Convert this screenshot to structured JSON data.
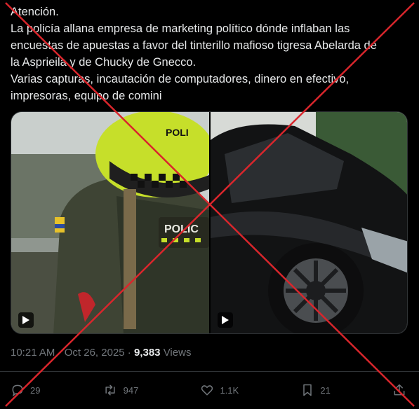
{
  "post": {
    "lines": [
      "Atención.",
      "La policía allana empresa de marketing político dónde inflaban las",
      "encuestas de apuestas a favor del tinterillo mafioso tigresa Abelarda de",
      "la Asprieila y de Chucky de Gnecco.",
      "Varias capturas, incautación de computadores, dinero en efectivo,",
      "impresoras, equipo de comini"
    ]
  },
  "media": {
    "left_vest_label": "POLI",
    "left_back_label": "POLIC"
  },
  "meta": {
    "time": "10:21 AM",
    "separator": " · ",
    "date": "Oct 26, 2025",
    "dot": " · ",
    "views_count": "9,383",
    "views_label": " Views"
  },
  "actions": {
    "replies": "29",
    "reposts": "947",
    "likes": "1.1K",
    "bookmarks": "21"
  },
  "colors": {
    "background": "#000000",
    "text": "#e7e9ea",
    "muted": "#71767b",
    "overlay_cross": "#d9262c"
  }
}
